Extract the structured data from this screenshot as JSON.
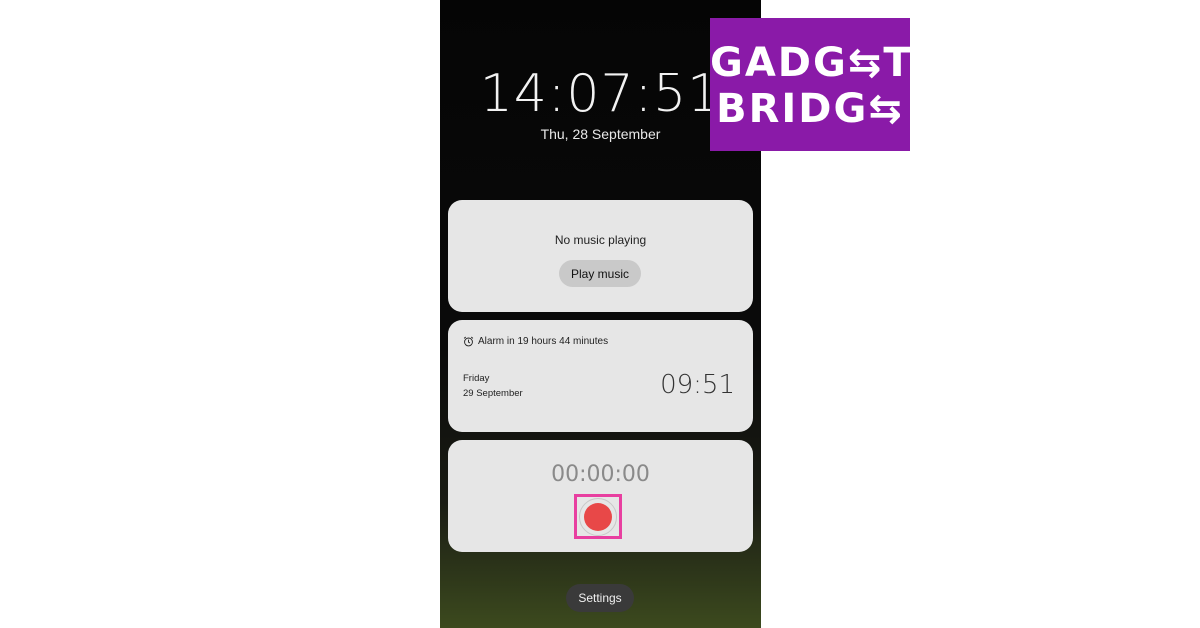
{
  "lockscreen": {
    "time": "14:07:51",
    "date": "Thu, 28 September"
  },
  "music_card": {
    "status": "No music playing",
    "play_label": "Play music"
  },
  "alarm_card": {
    "header": "Alarm in 19 hours 44 minutes",
    "day": "Friday",
    "date": "29 September",
    "time": "09:51",
    "icon": "alarm-clock-icon"
  },
  "recorder_card": {
    "elapsed": "00:00:00",
    "record_icon": "record-icon",
    "record_color": "#e84848",
    "highlight_color": "#e83fa0"
  },
  "settings_label": "Settings",
  "logo": {
    "line1": "GADG⇆T",
    "line2": "BRIDG⇆",
    "background": "#8a1aa8"
  }
}
